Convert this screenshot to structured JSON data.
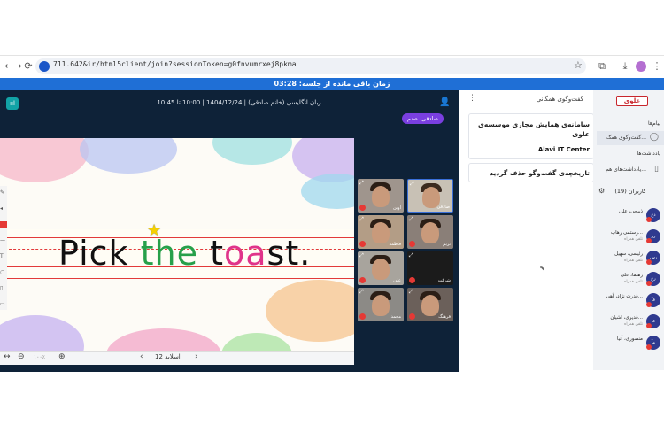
{
  "browser": {
    "url": "711.642&ir/html5client/join?sessionToken=g0fnvumrxej8pkma",
    "back": "←",
    "forward": "→",
    "reload": "⟳",
    "star": "☆"
  },
  "timer": {
    "text": "زمان باقی مانده از جلسه: 03:28"
  },
  "meeting": {
    "class_title": "زبان انگلیسی (خانم صادقی) | 1404/12/24 | 10:00 تا 10:45",
    "presenter": "صادقی، صنم",
    "slide": {
      "words": [
        {
          "text": "Pick ",
          "color": "black"
        },
        {
          "text": "the ",
          "color": "green"
        },
        {
          "text": "t",
          "color": "black"
        },
        {
          "text": "oa",
          "color": "pink"
        },
        {
          "text": "st.",
          "color": "black"
        }
      ]
    },
    "slide_footer": {
      "page_label": "اسلاید 12",
      "zoom": "۱۰۰٪"
    },
    "tiles": [
      {
        "name": "صادقی"
      },
      {
        "name": "آوین"
      },
      {
        "name": "ترنم"
      },
      {
        "name": "فاطمه"
      },
      {
        "name": "شرکت"
      },
      {
        "name": "علی"
      },
      {
        "name": "فرهنگ"
      },
      {
        "name": "محمد"
      }
    ]
  },
  "chat": {
    "title": "گفت‌وگوی همگانی",
    "message": "سامانه‌ی همایش مجازی موسسه‌ی علوی",
    "sender": "Alavi IT Center",
    "history_notice": "تاریخچه‌ی گفت‌وگو حذف گردید"
  },
  "sidebar": {
    "logo": "علوی",
    "messages_section": "پیام‌ها",
    "public_chat": "گفت‌وگوی همگ...",
    "notes_section": "یادداشت‌ها",
    "shared_notes": "یادداشت‌های هم...",
    "users_header": "کاربران (19)",
    "users": [
      {
        "name": "ذبیحی، علی",
        "role": "",
        "initials": "ذع"
      },
      {
        "name": "رستمی رهاب...",
        "role": "تلفن همراه",
        "initials": "رر"
      },
      {
        "name": "رئیسی، سهیل",
        "role": "تلفن همراه",
        "initials": "رس"
      },
      {
        "name": "رهنما، علی",
        "role": "تلفن همراه",
        "initials": "رع"
      },
      {
        "name": "قدرت نژاد، آهی...",
        "role": "",
        "initials": "قآ"
      },
      {
        "name": "قدیری، اشیان...",
        "role": "تلفن همراه",
        "initials": "قا"
      },
      {
        "name": "منصوری، آنیا",
        "role": "",
        "initials": "مآ"
      }
    ]
  }
}
